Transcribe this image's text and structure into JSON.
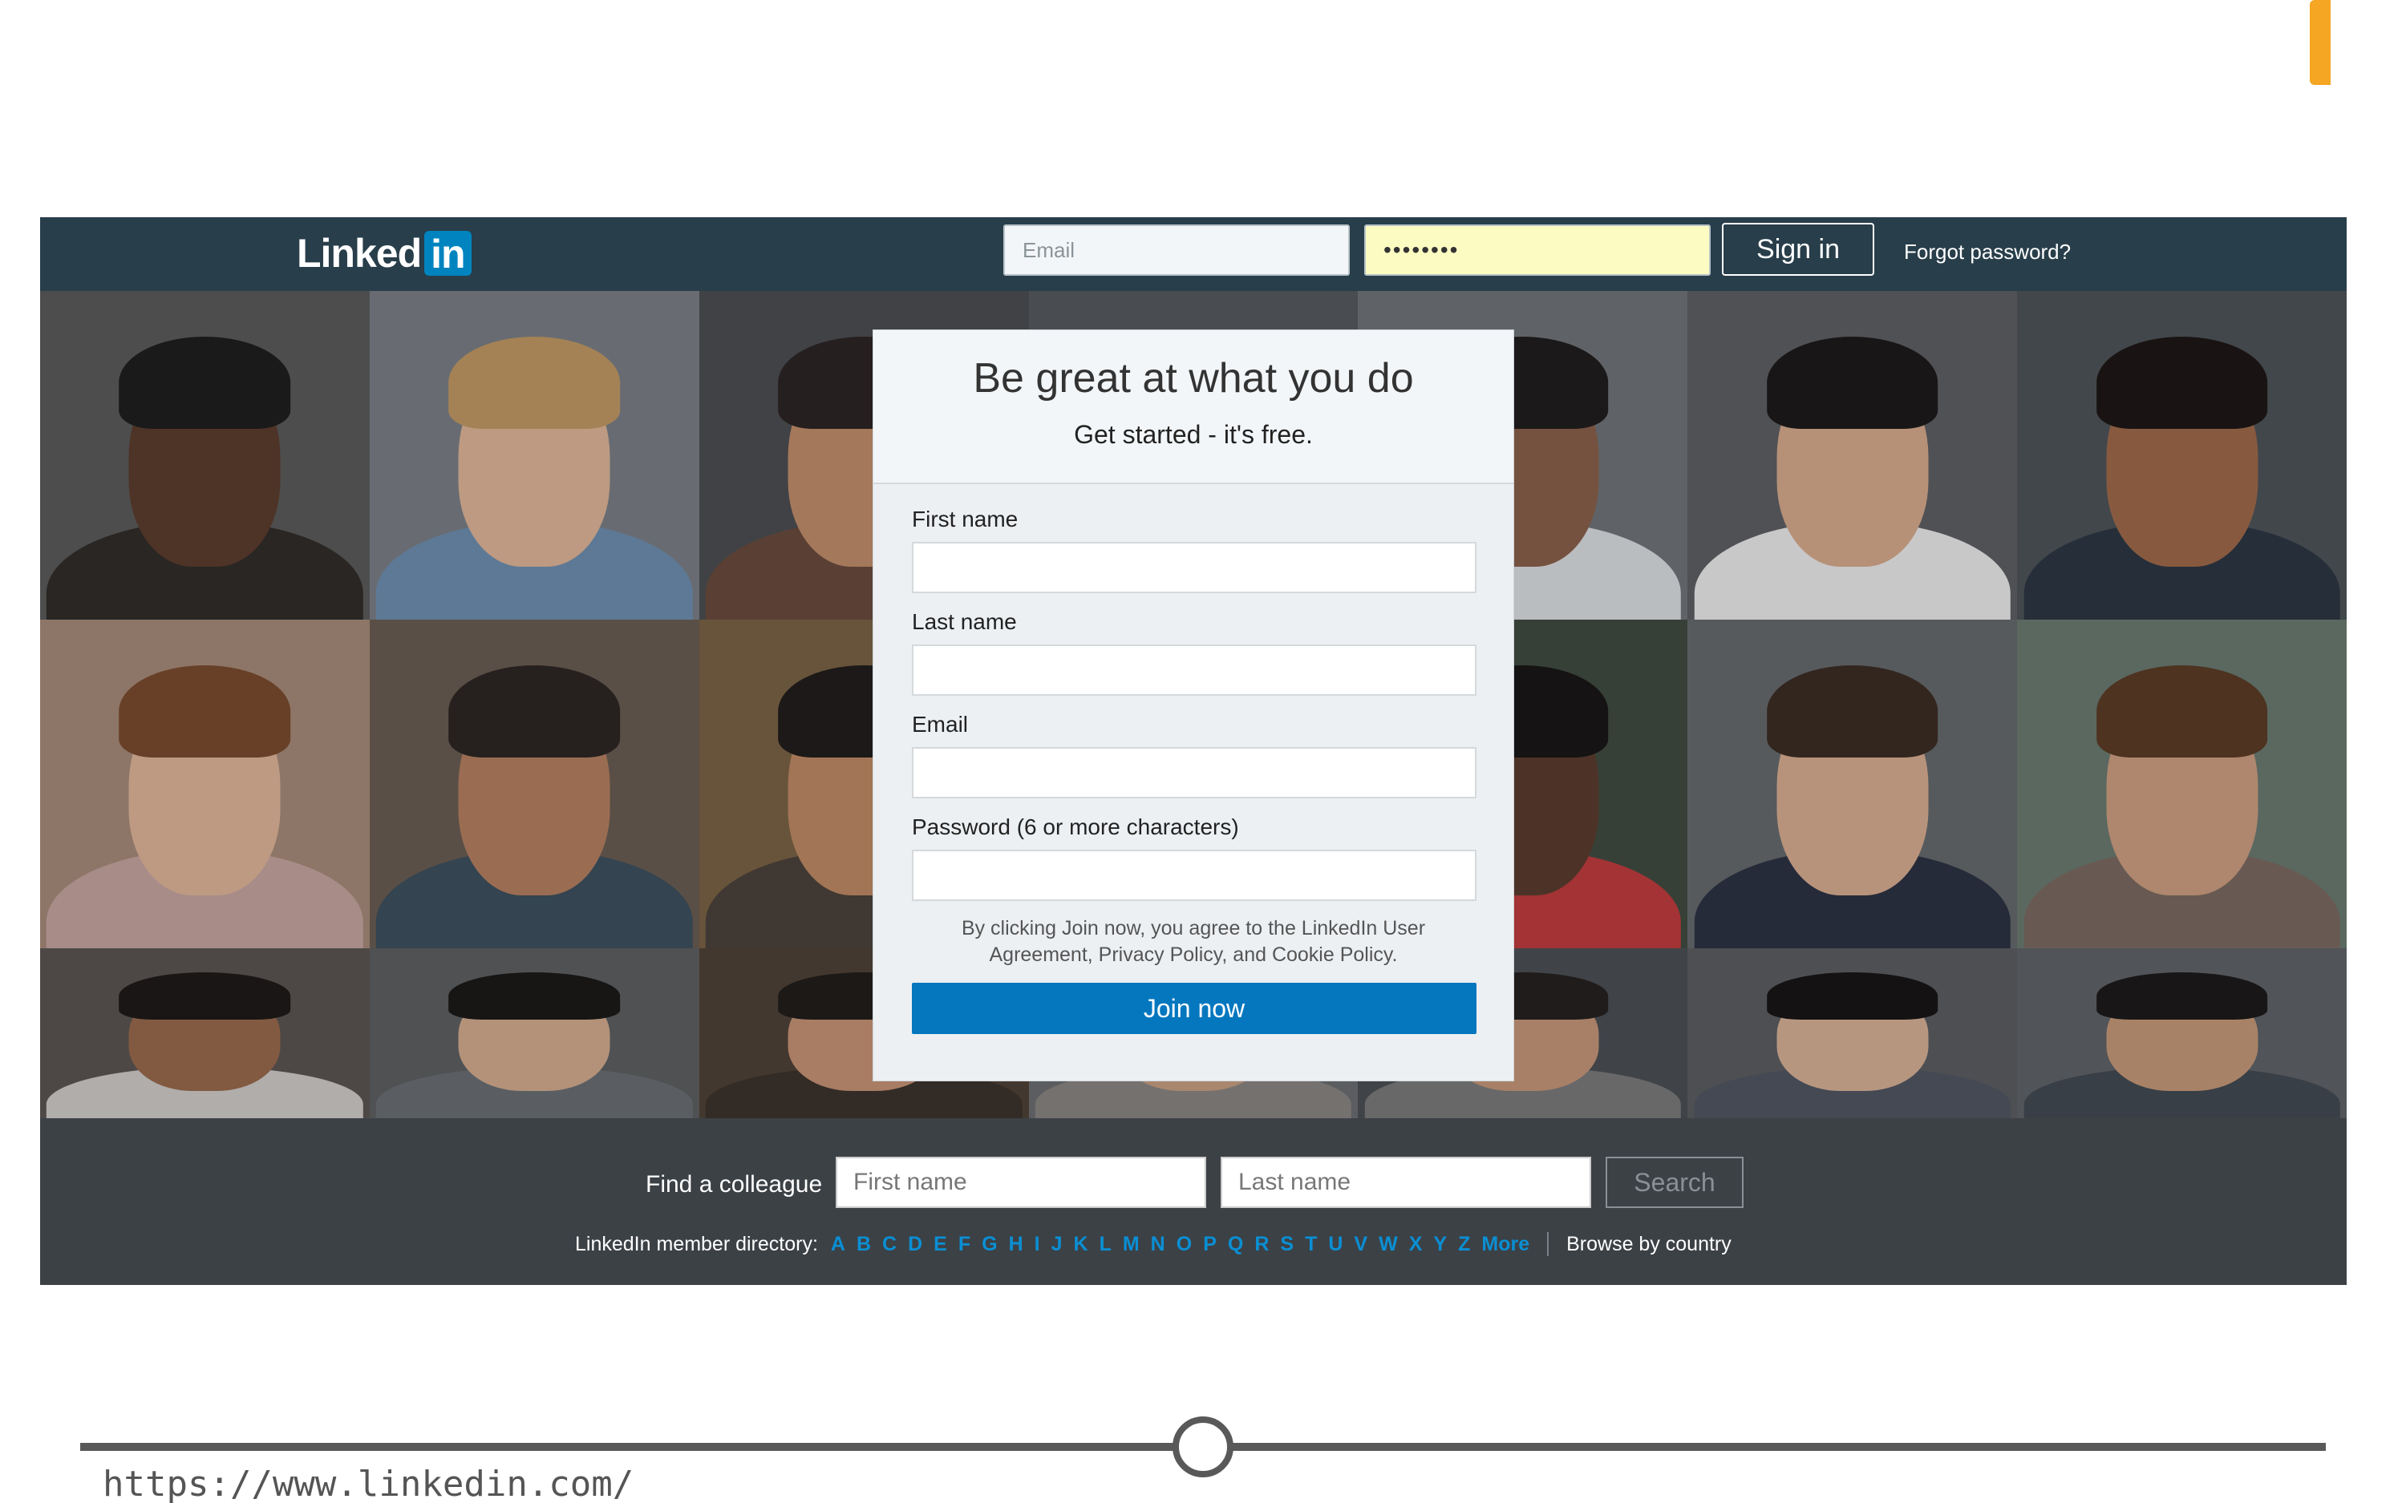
{
  "header": {
    "logo_text": "Linked",
    "logo_badge": "in",
    "email_placeholder": "Email",
    "password_value": "••••••••",
    "signin_label": "Sign in",
    "forgot_label": "Forgot password?"
  },
  "signup": {
    "title": "Be great at what you do",
    "subtitle": "Get started - it's free.",
    "first_name_label": "First name",
    "last_name_label": "Last name",
    "email_label": "Email",
    "password_label": "Password (6 or more characters)",
    "legal_text": "By clicking Join now, you agree to the LinkedIn User Agreement, Privacy Policy, and Cookie Policy.",
    "join_label": "Join now"
  },
  "footer": {
    "find_label": "Find a colleague",
    "first_placeholder": "First name",
    "last_placeholder": "Last name",
    "search_label": "Search",
    "directory_label": "LinkedIn member directory:",
    "letters": [
      "A",
      "B",
      "C",
      "D",
      "E",
      "F",
      "G",
      "H",
      "I",
      "J",
      "K",
      "L",
      "M",
      "N",
      "O",
      "P",
      "Q",
      "R",
      "S",
      "T",
      "U",
      "V",
      "W",
      "X",
      "Y",
      "Z"
    ],
    "more_label": "More",
    "browse_label": "Browse by country"
  },
  "slide": {
    "url": "https://www.linkedin.com/"
  },
  "colors": {
    "topbar": "#283e4a",
    "brand_blue": "#0084bf",
    "join_button": "#0477bf",
    "footer_bg": "#3c4146",
    "directory_link": "#0a8fd4"
  }
}
